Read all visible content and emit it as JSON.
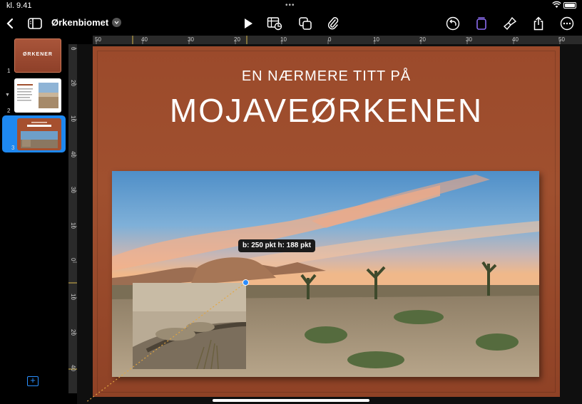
{
  "status": {
    "time": "kl. 9.41"
  },
  "toolbar": {
    "doc_title": "Ørkenbiomet",
    "icons": [
      "back-chevron",
      "sidebar-toggle",
      "play",
      "table-chart",
      "shapes",
      "attachment",
      "undo",
      "format-selected",
      "brush",
      "share",
      "more"
    ]
  },
  "sidebar": {
    "slides": [
      {
        "number": "1",
        "thumb_text": "ØRKENER"
      },
      {
        "number": "2",
        "thumb_text": ""
      },
      {
        "number": "3",
        "thumb_text": "",
        "selected": true
      }
    ]
  },
  "rulers": {
    "h_labels": [
      "50",
      "40",
      "30",
      "20",
      "10",
      "0",
      "10",
      "20",
      "30",
      "40",
      "50"
    ],
    "v_labels": [
      "0",
      "10",
      "20",
      "30",
      "40",
      "30",
      "20",
      "10",
      "0",
      "10",
      "20",
      "30",
      "40"
    ]
  },
  "slide": {
    "subtitle": "EN NÆRMERE TITT PÅ",
    "title": "MOJAVEØRKENEN"
  },
  "tooltip": "b: 250 pkt  h: 188 pkt",
  "colors": {
    "slide_bg": "#9b4a2b",
    "accent": "#1e88f0",
    "format_icon": "#8b6cf0"
  }
}
